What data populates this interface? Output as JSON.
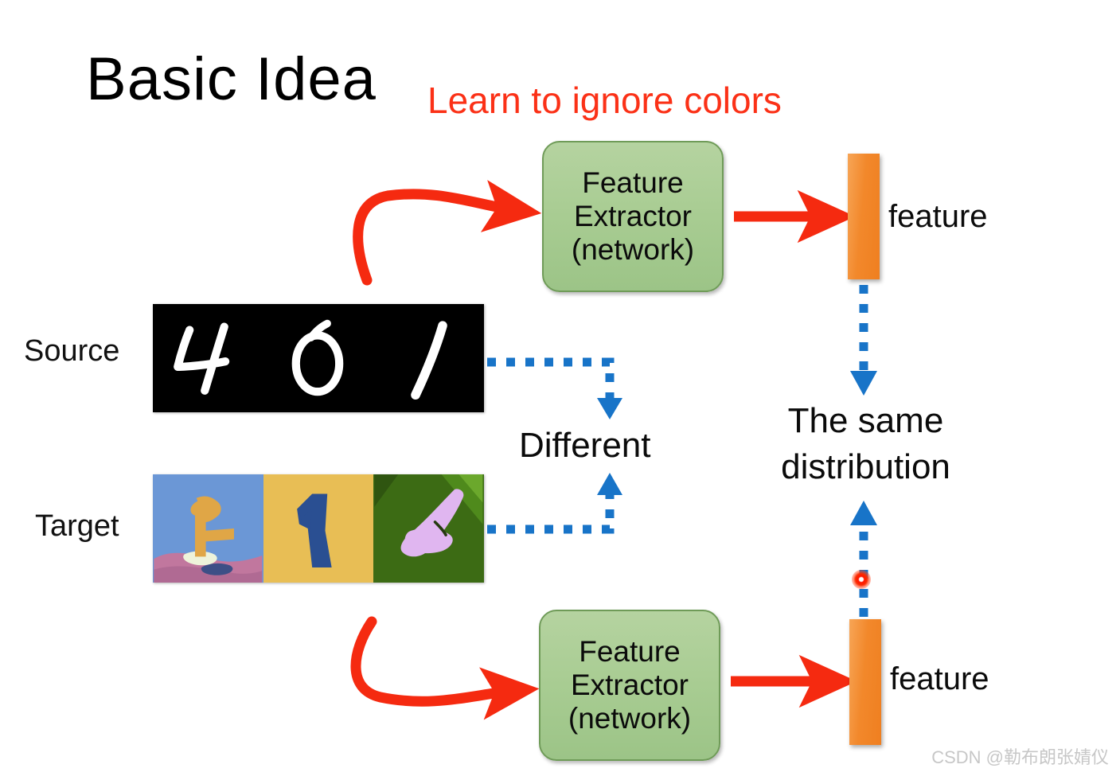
{
  "slide": {
    "title": "Basic Idea",
    "red_heading": "Learn to ignore colors",
    "watermark": "CSDN @勒布朗张婧仪"
  },
  "rows": {
    "source_label": "Source",
    "target_label": "Target"
  },
  "source_images": {
    "background": "#000000",
    "digits": [
      {
        "value": "4",
        "ink": "#ffffff",
        "background": "#000000"
      },
      {
        "value": "0",
        "ink": "#ffffff",
        "background": "#000000"
      },
      {
        "value": "1",
        "ink": "#ffffff",
        "background": "#000000"
      }
    ]
  },
  "target_images": {
    "digits": [
      {
        "value": "4",
        "ink": "#e0a646",
        "background": "#6b97d6",
        "ground": "#c1779e"
      },
      {
        "value": "1",
        "ink": "#2a4f92",
        "background": "#e8be55",
        "ground": "#e8be55"
      },
      {
        "value": "4",
        "ink": "#e0b6f0",
        "background": "#3c6b14",
        "ground": "#3c6b14"
      }
    ]
  },
  "feature_extractor": {
    "lines": [
      "Feature",
      "Extractor",
      "(network)"
    ],
    "fill": "#a8cc92",
    "border": "#6f9b58"
  },
  "features": {
    "top_label": "feature",
    "bottom_label": "feature",
    "bar_color": "#f2882b"
  },
  "annotations": {
    "different": "Different",
    "same_distribution_line1": "The same",
    "same_distribution_line2": "distribution"
  },
  "colors": {
    "red_arrow": "#F52A10",
    "blue_dotted": "#1874C8",
    "red_heading": "#FB3117",
    "laser_dot": "#FF1500"
  },
  "chart_data": {
    "type": "diagram",
    "title": "Basic Idea",
    "nodes": [
      {
        "id": "source",
        "label": "Source",
        "kind": "image-strip"
      },
      {
        "id": "target",
        "label": "Target",
        "kind": "image-strip"
      },
      {
        "id": "fe-top",
        "label": "Feature Extractor (network)",
        "kind": "process"
      },
      {
        "id": "fe-bottom",
        "label": "Feature Extractor (network)",
        "kind": "process"
      },
      {
        "id": "feat-top",
        "label": "feature",
        "kind": "vector"
      },
      {
        "id": "feat-bottom",
        "label": "feature",
        "kind": "vector"
      }
    ],
    "edges": [
      {
        "from": "source",
        "to": "fe-top",
        "style": "red-curved-arrow"
      },
      {
        "from": "target",
        "to": "fe-bottom",
        "style": "red-curved-arrow"
      },
      {
        "from": "fe-top",
        "to": "feat-top",
        "style": "red-straight-arrow"
      },
      {
        "from": "fe-bottom",
        "to": "feat-bottom",
        "style": "red-straight-arrow"
      },
      {
        "from": "source",
        "to": "different",
        "style": "blue-dotted"
      },
      {
        "from": "target",
        "to": "different",
        "style": "blue-dotted"
      },
      {
        "from": "feat-top",
        "to": "same-distribution",
        "style": "blue-dotted-arrow"
      },
      {
        "from": "feat-bottom",
        "to": "same-distribution",
        "style": "blue-dotted-arrow"
      }
    ]
  }
}
